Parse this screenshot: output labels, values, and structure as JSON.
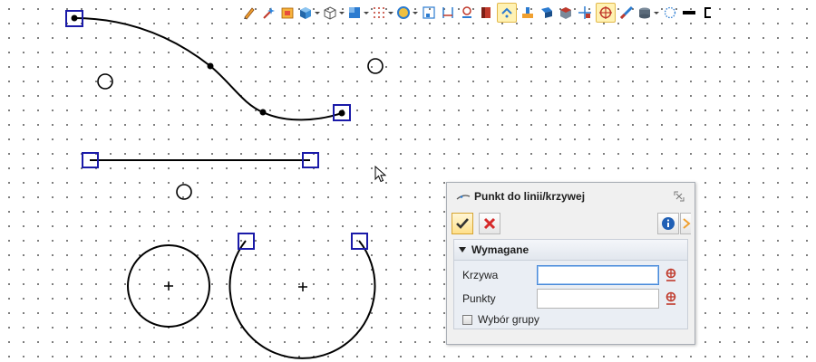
{
  "colors": {
    "canvas_bg": "#ffffff",
    "grid_dot": "#5a5a5a",
    "curve": "#000000",
    "handle": "#1a1aa8",
    "dialog_bg": "#f0f0f0",
    "accent": "#e2b84a",
    "cancel_red": "#d62a2a"
  },
  "toolbar": {
    "items": [
      {
        "icon": "sketch-pencil-icon"
      },
      {
        "icon": "magic-wand-icon"
      },
      {
        "icon": "filter-icon"
      },
      {
        "icon": "view-cube-icon",
        "dropdown": true
      },
      {
        "icon": "wireframe-cube-icon",
        "dropdown": true
      },
      {
        "icon": "view-plane-icon",
        "dropdown": true
      },
      {
        "icon": "grid-icon",
        "dropdown": true
      },
      {
        "icon": "render-mode-icon",
        "dropdown": true
      },
      {
        "icon": "snap-icon"
      },
      {
        "icon": "dimension-icon"
      },
      {
        "icon": "anchor-icon"
      },
      {
        "icon": "material-icon"
      },
      {
        "icon": "curve-snap-icon",
        "active": true
      },
      {
        "icon": "workplane-icon"
      },
      {
        "icon": "section-icon"
      },
      {
        "icon": "shaded-icon"
      },
      {
        "icon": "cross-point-icon"
      },
      {
        "icon": "target-icon",
        "active": true
      },
      {
        "icon": "slash-icon"
      },
      {
        "icon": "layer-icon",
        "dropdown": true
      },
      {
        "icon": "dotted-circle-icon"
      },
      {
        "icon": "line-style-icon"
      },
      {
        "icon": "overflow-icon"
      }
    ]
  },
  "dialog": {
    "title": "Punkt do linii/krzywej",
    "title_icon": "point-to-curve-icon",
    "actions": {
      "ok_icon": "check-icon",
      "cancel_icon": "close-x-icon",
      "info_icon": "info-icon",
      "help_icon": "help-icon"
    },
    "section": {
      "title": "Wymagane",
      "fields": [
        {
          "label": "Krzywa",
          "value": "",
          "focused": true
        },
        {
          "label": "Punkty",
          "value": ""
        }
      ],
      "checkbox": {
        "label": "Wybór grupy",
        "checked": false
      }
    }
  }
}
